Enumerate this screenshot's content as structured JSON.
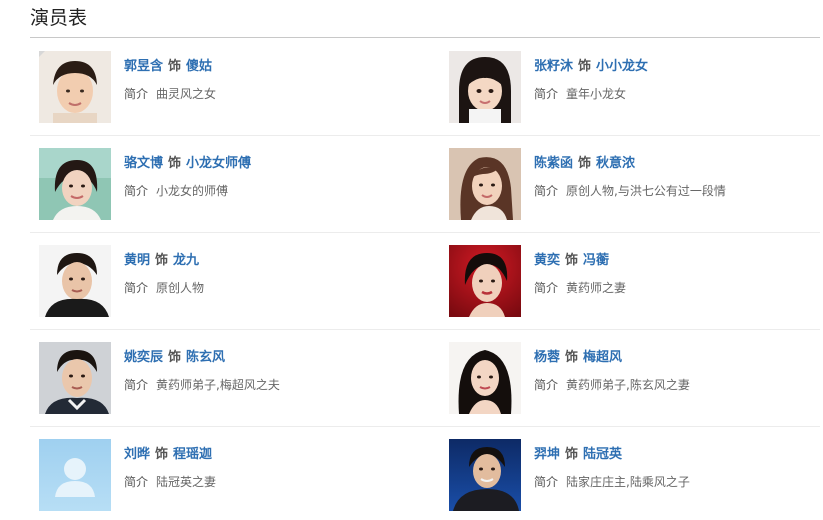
{
  "section": {
    "title": "演员表"
  },
  "cast": [
    {
      "actor": "郭昱含",
      "as": "饰",
      "role": "傻姑",
      "intro_label": "简介",
      "intro": "曲灵风之女"
    },
    {
      "actor": "张籽沐",
      "as": "饰",
      "role": "小小龙女",
      "intro_label": "简介",
      "intro": "童年小龙女"
    },
    {
      "actor": "骆文博",
      "as": "饰",
      "role": "小龙女师傅",
      "intro_label": "简介",
      "intro": "小龙女的师傅"
    },
    {
      "actor": "陈紫函",
      "as": "饰",
      "role": "秋意浓",
      "intro_label": "简介",
      "intro": "原创人物,与洪七公有过一段情"
    },
    {
      "actor": "黄明",
      "as": "饰",
      "role": "龙九",
      "intro_label": "简介",
      "intro": "原创人物"
    },
    {
      "actor": "黄奕",
      "as": "饰",
      "role": "冯蘅",
      "intro_label": "简介",
      "intro": "黄药师之妻"
    },
    {
      "actor": "姚奕辰",
      "as": "饰",
      "role": "陈玄风",
      "intro_label": "简介",
      "intro": "黄药师弟子,梅超风之夫"
    },
    {
      "actor": "杨蓉",
      "as": "饰",
      "role": "梅超风",
      "intro_label": "简介",
      "intro": "黄药师弟子,陈玄风之妻"
    },
    {
      "actor": "刘晔",
      "as": "饰",
      "role": "程瑶迦",
      "intro_label": "简介",
      "intro": "陆冠英之妻"
    },
    {
      "actor": "羿坤",
      "as": "饰",
      "role": "陆冠英",
      "intro_label": "简介",
      "intro": "陆家庄庄主,陆乘风之子"
    }
  ],
  "colors": {
    "link": "#2e6fb2",
    "text": "#666666",
    "divider": "#ececec"
  },
  "icons": {
    "placeholder": "default-avatar-icon"
  }
}
